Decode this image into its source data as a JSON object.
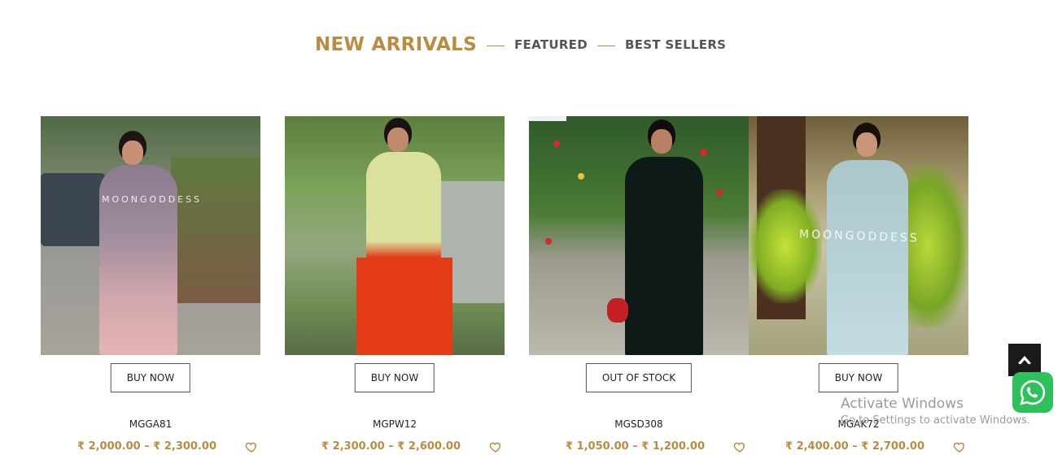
{
  "tabs": {
    "new_arrivals": "NEW ARRIVALS",
    "featured": "FEATURED",
    "best_sellers": "BEST SELLERS"
  },
  "colors": {
    "accent": "#b98c3f",
    "whatsapp": "#2ec15b"
  },
  "products": [
    {
      "name": "MGGA81",
      "price": "₹ 2,000.00 – ₹ 2,300.00",
      "button": "BUY NOW",
      "watermark": "MOONGODDESS"
    },
    {
      "name": "MGPW12",
      "price": "₹ 2,300.00 – ₹ 2,600.00",
      "button": "BUY NOW"
    },
    {
      "name": "MGSD308",
      "price": "₹ 1,050.00 – ₹ 1,200.00",
      "button": "OUT OF STOCK"
    },
    {
      "name": "MGAK72",
      "price": "₹ 2,400.00 – ₹ 2,700.00",
      "button": "BUY NOW",
      "watermark": "MOONGODDESS"
    }
  ],
  "icons": {
    "wishlist": "heart-outline-icon",
    "back_to_top": "arrow-up-icon",
    "chat": "whatsapp-icon"
  },
  "os_notice": {
    "title": "Activate Windows",
    "subtitle": "Go to Settings to activate Windows."
  }
}
